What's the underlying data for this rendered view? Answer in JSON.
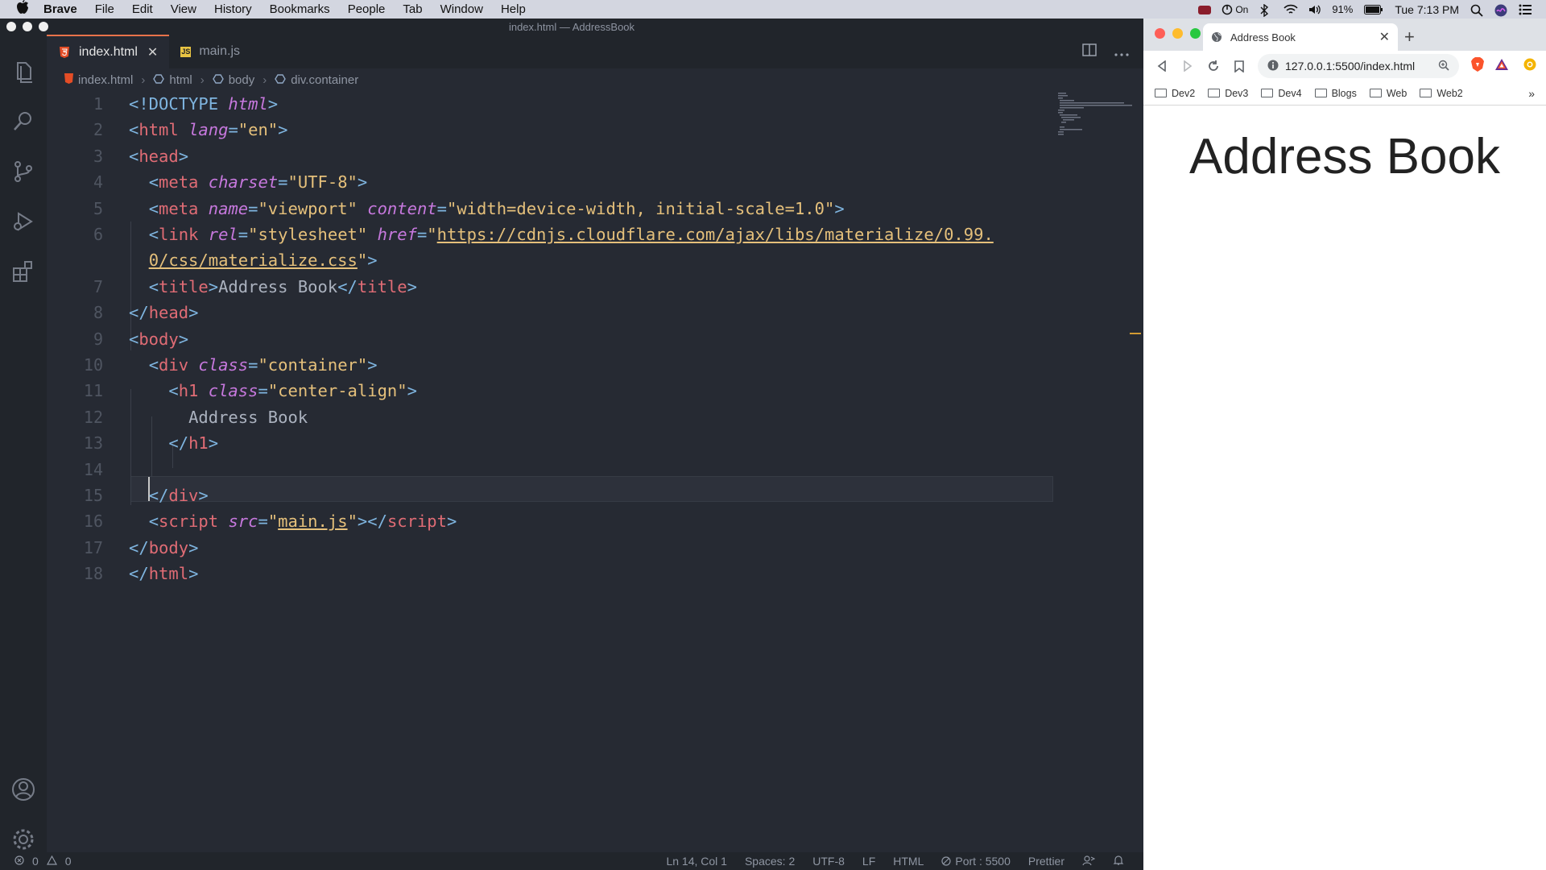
{
  "menubar": {
    "app": "Brave",
    "items": [
      "File",
      "Edit",
      "View",
      "History",
      "Bookmarks",
      "People",
      "Tab",
      "Window",
      "Help"
    ],
    "status_on": "On",
    "battery": "91%",
    "clock": "Tue 7:13 PM"
  },
  "vscode": {
    "window_title": "index.html — AddressBook",
    "tabs": [
      {
        "label": "index.html",
        "icon": "html5-icon"
      },
      {
        "label": "main.js",
        "icon": "js-icon"
      }
    ],
    "breadcrumb": [
      "index.html",
      "html",
      "body",
      "div.container"
    ],
    "line_numbers": [
      "1",
      "2",
      "3",
      "4",
      "5",
      "6",
      "",
      "7",
      "8",
      "9",
      "10",
      "11",
      "12",
      "13",
      "14",
      "15",
      "16",
      "17",
      "18"
    ],
    "code": {
      "l1a": "<!DOCTYPE ",
      "l1b": "html",
      "l1c": ">",
      "l2_tag": "html",
      "l2_attr": "lang",
      "l2_val": "\"en\"",
      "l3_tag": "head",
      "l4_tag": "meta",
      "l4_attr": "charset",
      "l4_val": "\"UTF-8\"",
      "l5_tag": "meta",
      "l5_attr1": "name",
      "l5_val1": "\"viewport\"",
      "l5_attr2": "content",
      "l5_val2": "\"width=device-width, initial-scale=1.0\"",
      "l6_tag": "link",
      "l6_attr1": "rel",
      "l6_val1": "\"stylesheet\"",
      "l6_attr2": "href",
      "l6_q": "\"",
      "l6_url1": "https://cdnjs.cloudflare.com/ajax/libs/materialize/0.99.",
      "l6_url2": "0/css/materialize.css",
      "l7_tag": "title",
      "l7_text": "Address Book",
      "l8_tag": "head",
      "l9_tag": "body",
      "l10_tag": "div",
      "l10_attr": "class",
      "l10_val": "\"container\"",
      "l11_tag": "h1",
      "l11_attr": "class",
      "l11_val": "\"center-align\"",
      "l12_text": "Address Book",
      "l13_tag": "h1",
      "l15_tag": "div",
      "l16_tag": "script",
      "l16_attr": "src",
      "l16_q": "\"",
      "l16_val": "main.js",
      "l17_tag": "body",
      "l18_tag": "html"
    },
    "status": {
      "errors": "0",
      "warnings": "0",
      "position": "Ln 14, Col 1",
      "spaces": "Spaces: 2",
      "encoding": "UTF-8",
      "eol": "LF",
      "language": "HTML",
      "port": "Port : 5500",
      "formatter": "Prettier"
    }
  },
  "browser": {
    "tab_title": "Address Book",
    "url": "127.0.0.1:5500/index.html",
    "bookmarks": [
      "Dev2",
      "Dev3",
      "Dev4",
      "Blogs",
      "Web",
      "Web2"
    ],
    "page_heading": "Address Book"
  },
  "colors": {
    "tag": "#e06c75",
    "attribute": "#c678dd",
    "string": "#e5c07b",
    "active_tab_accent": "#e8724a"
  }
}
